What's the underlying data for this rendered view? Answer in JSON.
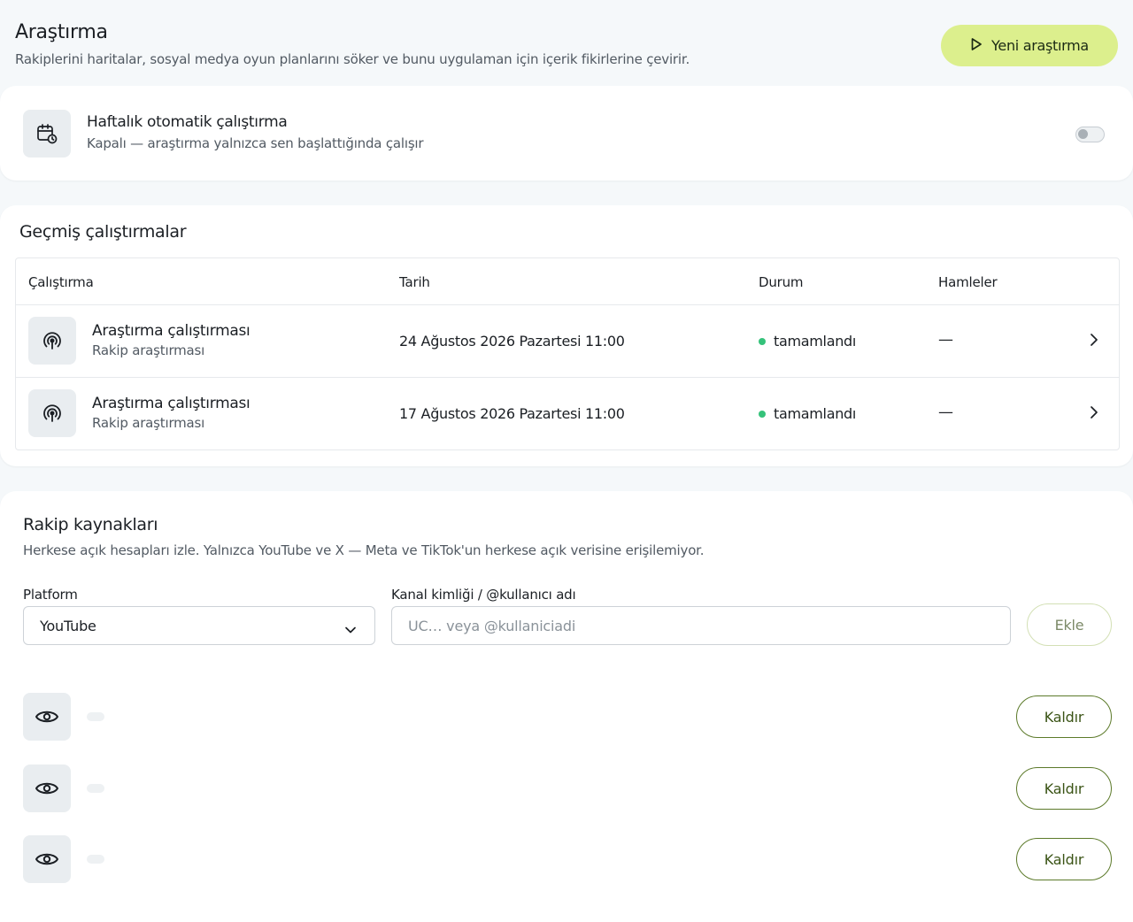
{
  "header": {
    "title": "Araştırma",
    "subtitle": "Rakiplerini haritalar, sosyal medya oyun planlarını söker ve bunu uygulaman için içerik fikirlerine çevirir.",
    "new_button_label": "Yeni araştırma",
    "new_button_icon": "play-icon"
  },
  "auto_run": {
    "icon": "calendar-clock-icon",
    "title": "Haftalık otomatik çalıştırma",
    "subtitle": "Kapalı — araştırma yalnızca sen başlattığında çalışır",
    "enabled": false
  },
  "history": {
    "title": "Geçmiş çalıştırmalar",
    "columns": [
      "Çalıştırma",
      "Tarih",
      "Durum",
      "Hamleler"
    ],
    "rows": [
      {
        "icon": "radar-icon",
        "name": "Araştırma çalıştırması",
        "sub": "Rakip araştırması",
        "date": "24 Ağustos 2026 Pazartesi 11:00",
        "status": "tamamlandı",
        "moves": "—"
      },
      {
        "icon": "radar-icon",
        "name": "Araştırma çalıştırması",
        "sub": "Rakip araştırması",
        "date": "17 Ağustos 2026 Pazartesi 11:00",
        "status": "tamamlandı",
        "moves": "—"
      }
    ]
  },
  "sources": {
    "title": "Rakip kaynakları",
    "subtitle": "Herkese açık hesapları izle. Yalnızca YouTube ve X — Meta ve TikTok'un herkese açık verisine erişilemiyor.",
    "platform_label": "Platform",
    "platform_value": "YouTube",
    "channel_label": "Kanal kimliği / @kullanıcı adı",
    "channel_placeholder": "UC… veya @kullaniciadi",
    "channel_value": "",
    "add_label": "Ekle",
    "items": [
      {
        "icon": "eye-icon",
        "remove_label": "Kaldır"
      },
      {
        "icon": "eye-icon",
        "remove_label": "Kaldır"
      },
      {
        "icon": "eye-icon",
        "remove_label": "Kaldır"
      }
    ]
  },
  "colors": {
    "accent": "#dcef8d",
    "status_done": "#35c27a",
    "remove_border": "#5c7a2a",
    "background": "#f5f8fa"
  }
}
